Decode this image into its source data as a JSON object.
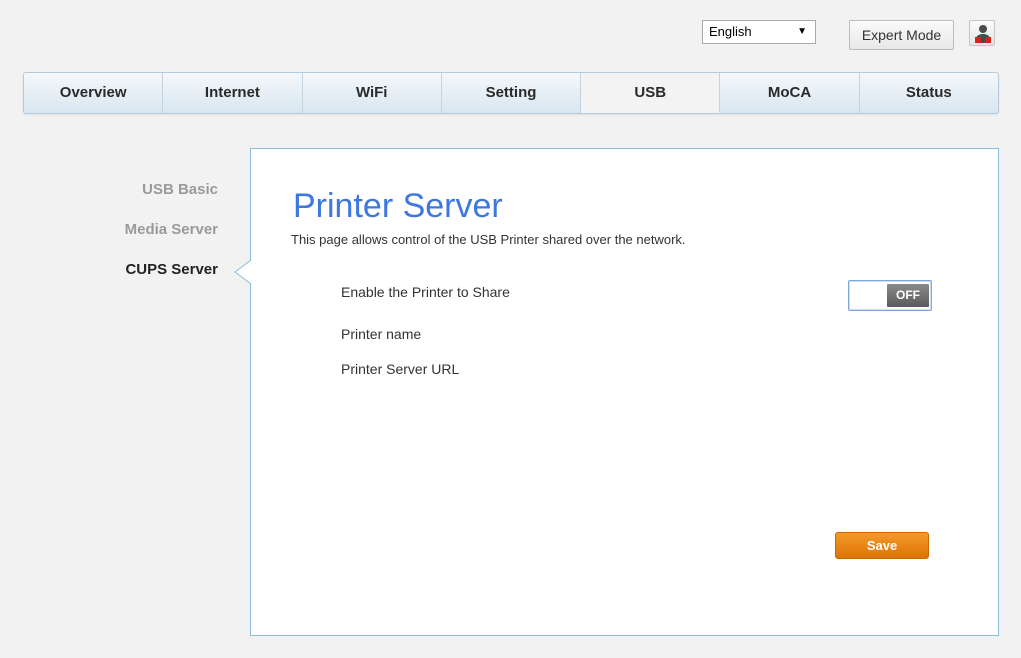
{
  "header": {
    "language": "English",
    "expert_mode": "Expert Mode"
  },
  "tabs": [
    {
      "label": "Overview"
    },
    {
      "label": "Internet"
    },
    {
      "label": "WiFi"
    },
    {
      "label": "Setting"
    },
    {
      "label": "USB",
      "active": true
    },
    {
      "label": "MoCA"
    },
    {
      "label": "Status"
    }
  ],
  "sidenav": [
    {
      "label": "USB Basic"
    },
    {
      "label": "Media Server"
    },
    {
      "label": "CUPS Server",
      "active": true
    }
  ],
  "main": {
    "title": "Printer Server",
    "description": "This page allows control of the USB Printer shared over the network.",
    "enable_label": "Enable the Printer to Share",
    "toggle_state": "OFF",
    "printer_name_label": "Printer name",
    "server_url_label": "Printer Server URL",
    "save_label": "Save"
  },
  "colors": {
    "title": "#3d77e0",
    "save": "#f08a1c",
    "panel_border": "#8fbcd6"
  }
}
